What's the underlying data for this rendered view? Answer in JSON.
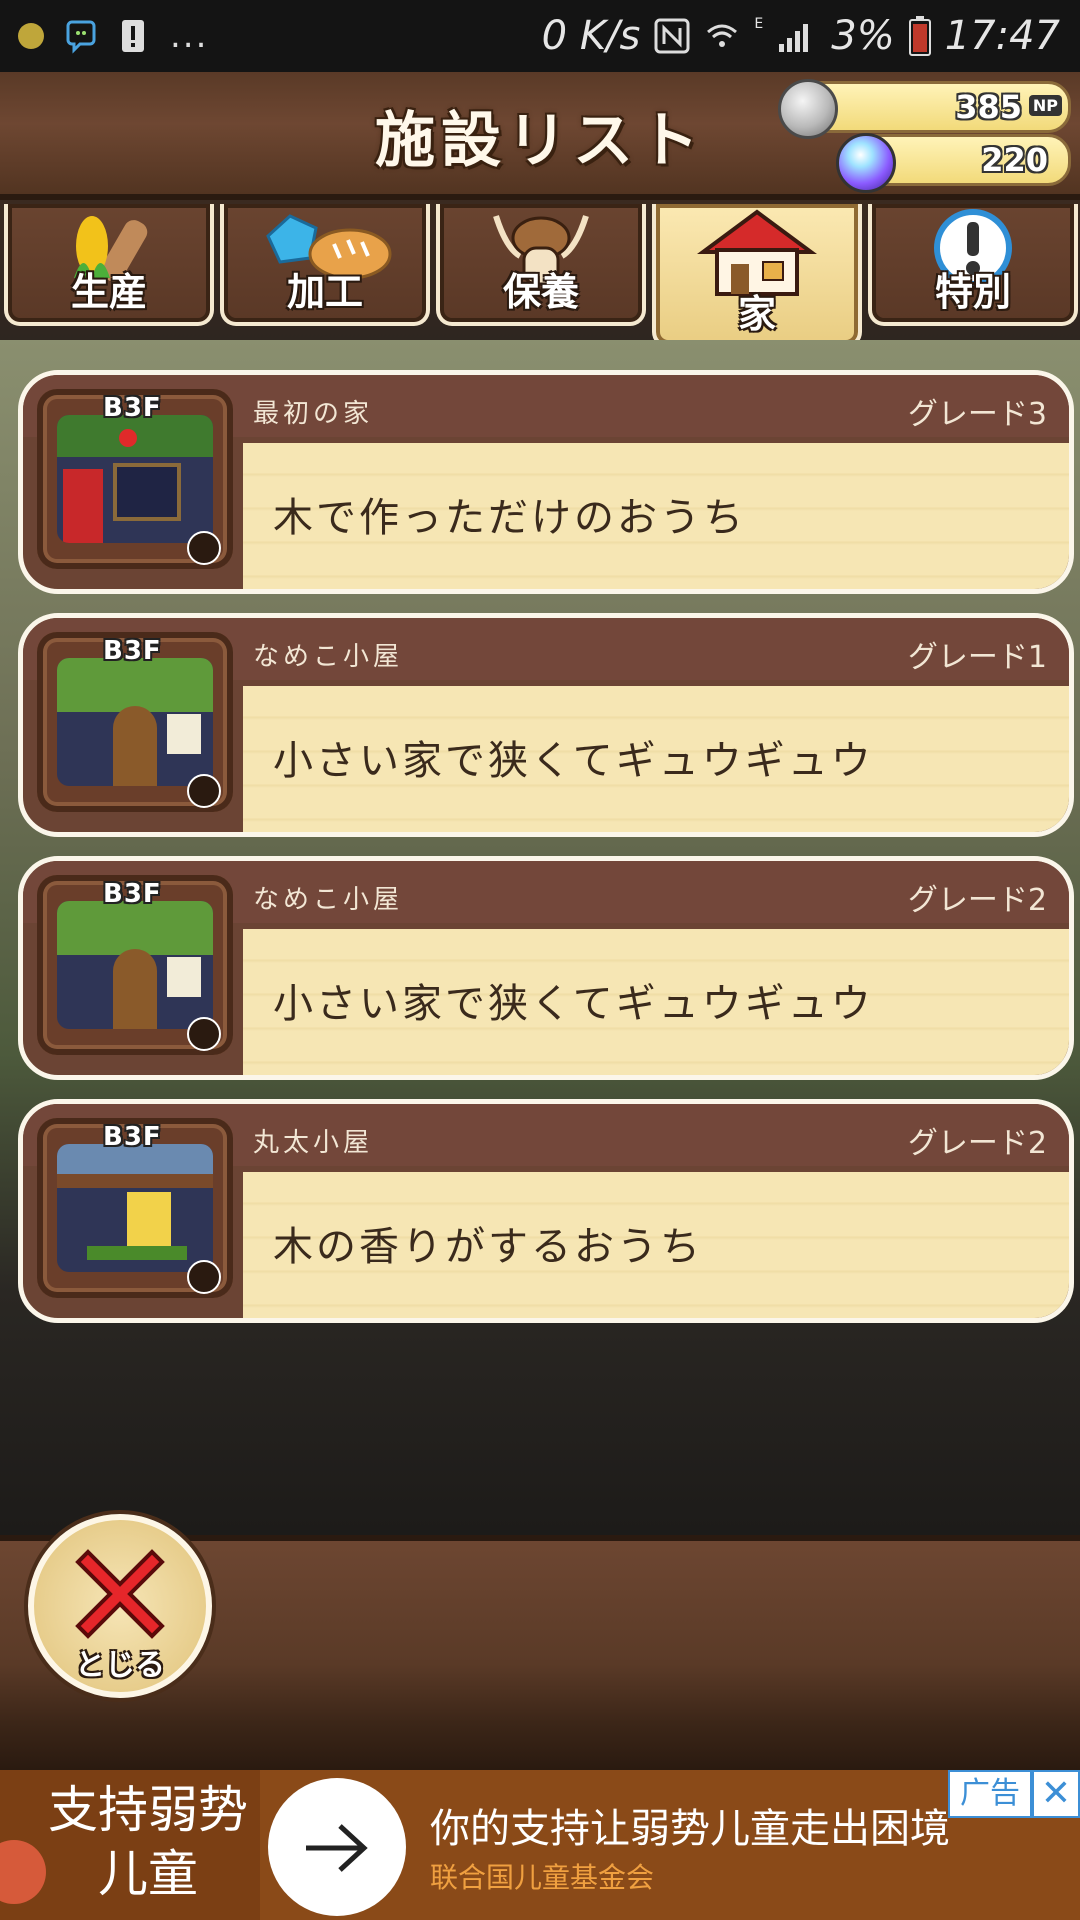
{
  "status_bar": {
    "network_speed": "0 K/s",
    "network_type": "E",
    "battery_percent": "3%",
    "time": "17:47",
    "overflow": "..."
  },
  "header": {
    "title": "施設リスト",
    "np_amount": "385",
    "np_unit": "NP",
    "gem_amount": "220"
  },
  "tabs": [
    {
      "label": "生産",
      "icon": "corn-log-icon",
      "active": false
    },
    {
      "label": "加工",
      "icon": "crystal-bread-icon",
      "active": false
    },
    {
      "label": "保養",
      "icon": "nameko-icon",
      "active": false
    },
    {
      "label": "家",
      "icon": "house-icon",
      "active": true
    },
    {
      "label": "特別",
      "icon": "exclamation-icon",
      "active": false
    }
  ],
  "facilities": [
    {
      "floor": "B3F",
      "name": "最初の家",
      "grade": "グレード3",
      "description": "木で作っただけのおうち",
      "thumbnail": "tree-house"
    },
    {
      "floor": "B3F",
      "name": "なめこ小屋",
      "grade": "グレード1",
      "description": "小さい家で狭くてギュウギュウ",
      "thumbnail": "leaf-hut"
    },
    {
      "floor": "B3F",
      "name": "なめこ小屋",
      "grade": "グレード2",
      "description": "小さい家で狭くてギュウギュウ",
      "thumbnail": "leaf-hut"
    },
    {
      "floor": "B3F",
      "name": "丸太小屋",
      "grade": "グレード2",
      "description": "木の香りがするおうち",
      "thumbnail": "log-cabin"
    }
  ],
  "close_button": {
    "label": "とじる"
  },
  "ad": {
    "left_text": "支持弱势儿童",
    "headline": "你的支持让弱势儿童走出困境",
    "sub": "联合国儿童基金会",
    "tag": "广告",
    "close": "✕"
  },
  "colors": {
    "wood_dark": "#5a3a27",
    "cream": "#f6e6b4",
    "item_header": "#73473a",
    "ad_bg": "#8a4a18",
    "ad_accent": "#3c8fd6"
  }
}
